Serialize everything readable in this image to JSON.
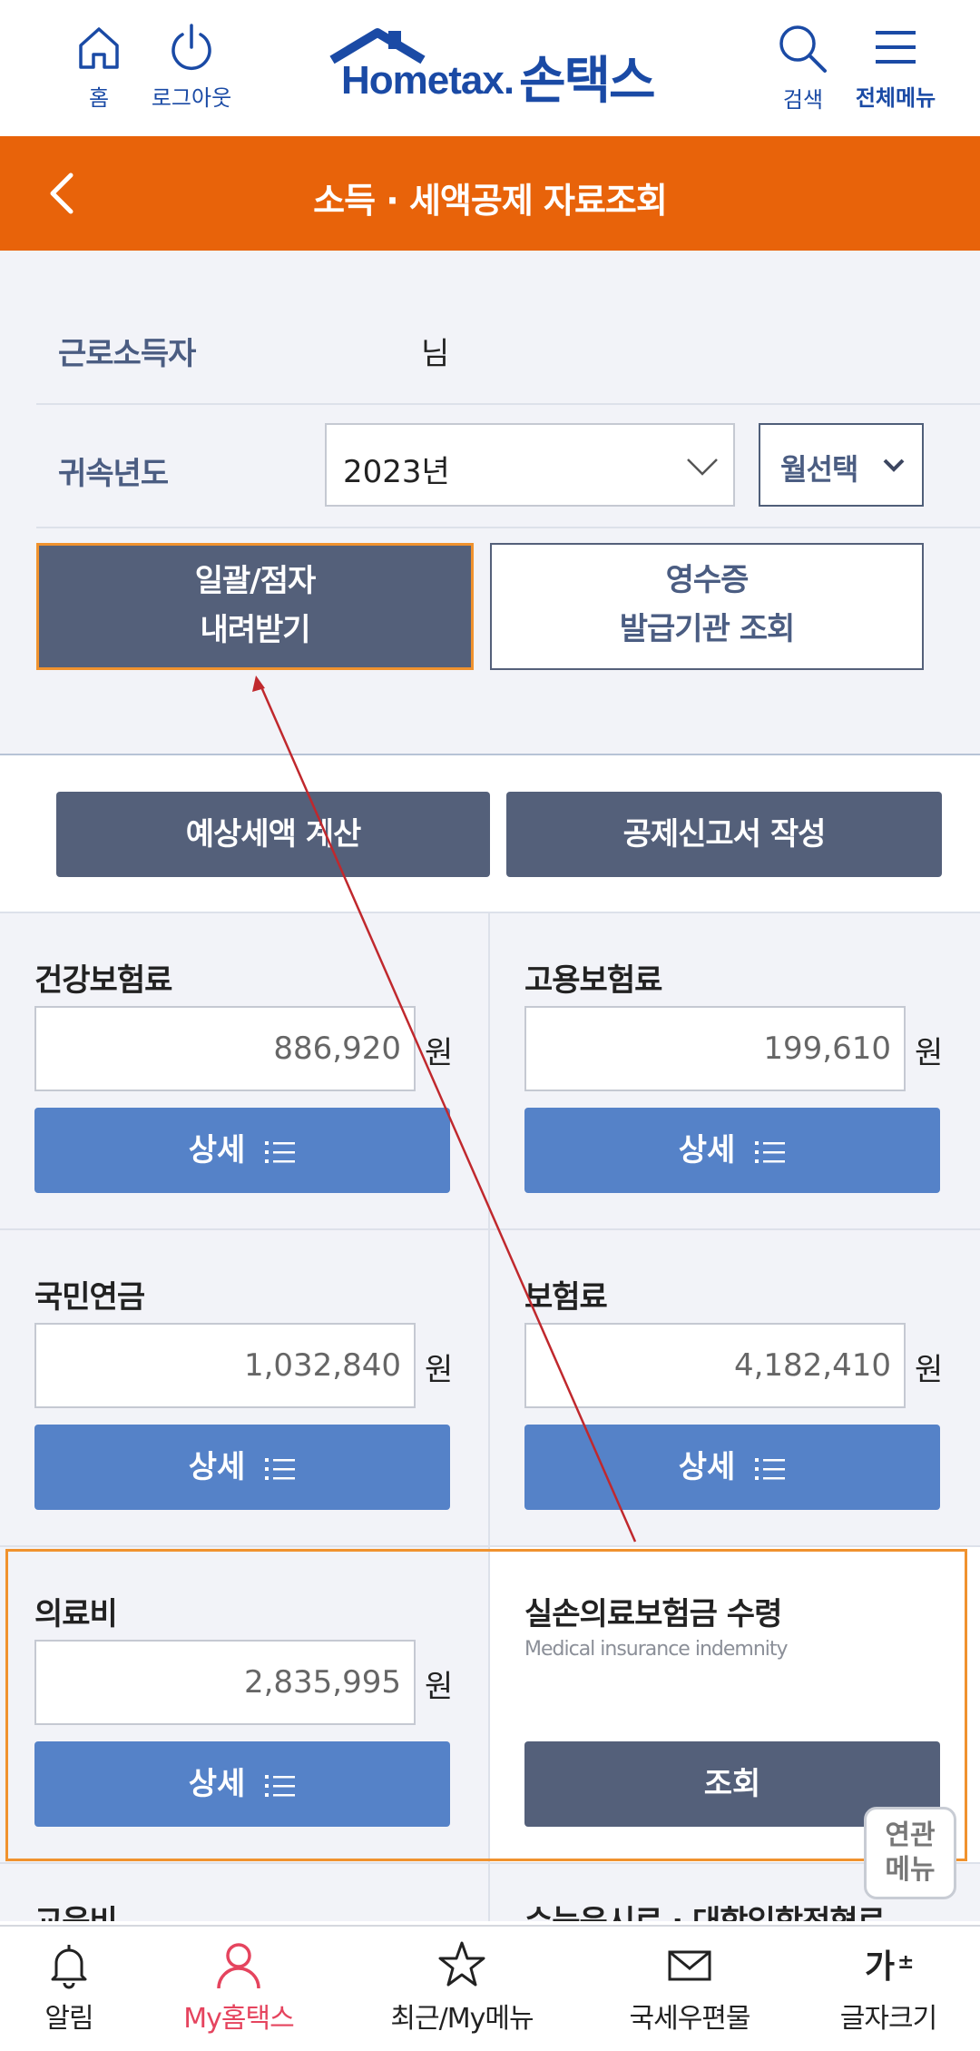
{
  "header": {
    "home_label": "홈",
    "logout_label": "로그아웃",
    "logo_text": "Hometax.",
    "logo_kr": "손택스",
    "search_label": "검색",
    "menu_label": "전체메뉴"
  },
  "titlebar": {
    "title": "소득 · 세액공제 자료조회"
  },
  "info": {
    "worker_label": "근로소득자",
    "worker_suffix": "님",
    "year_label": "귀속년도",
    "year_value": "2023년",
    "month_label": "월선택",
    "download_line1": "일괄/점자",
    "download_line2": "내려받기",
    "receipt_line1": "영수증",
    "receipt_line2": "발급기관 조회"
  },
  "actions": {
    "estimate_label": "예상세액 계산",
    "report_label": "공제신고서 작성"
  },
  "cells": [
    {
      "title": "건강보험료",
      "amount": "886,920",
      "unit": "원",
      "detail": "상세"
    },
    {
      "title": "고용보험료",
      "amount": "199,610",
      "unit": "원",
      "detail": "상세"
    },
    {
      "title": "국민연금",
      "amount": "1,032,840",
      "unit": "원",
      "detail": "상세"
    },
    {
      "title": "보험료",
      "amount": "4,182,410",
      "unit": "원",
      "detail": "상세"
    },
    {
      "title": "의료비",
      "amount": "2,835,995",
      "unit": "원",
      "detail": "상세"
    }
  ],
  "indemnity": {
    "title": "실손의료보험금 수령",
    "subtitle": "Medical insurance indemnity",
    "query_label": "조회"
  },
  "peek": {
    "left": "교육비",
    "right": "수능응시료 · 대학입학전형료"
  },
  "related_menu": {
    "line1": "연관",
    "line2": "메뉴"
  },
  "bottom_nav": [
    {
      "label": "알림",
      "icon": "bell-icon"
    },
    {
      "label": "My홈택스",
      "icon": "person-icon"
    },
    {
      "label": "최근/My메뉴",
      "icon": "star-icon"
    },
    {
      "label": "국세우편물",
      "icon": "mail-icon"
    },
    {
      "label": "글자크기",
      "icon": "font-size-icon"
    }
  ],
  "colors": {
    "brand_blue": "#1a4aa5",
    "title_orange": "#e8630a",
    "dark_button": "#54607a",
    "detail_blue": "#5582c8",
    "highlight": "#f0922e",
    "active_nav": "#e5445e"
  }
}
